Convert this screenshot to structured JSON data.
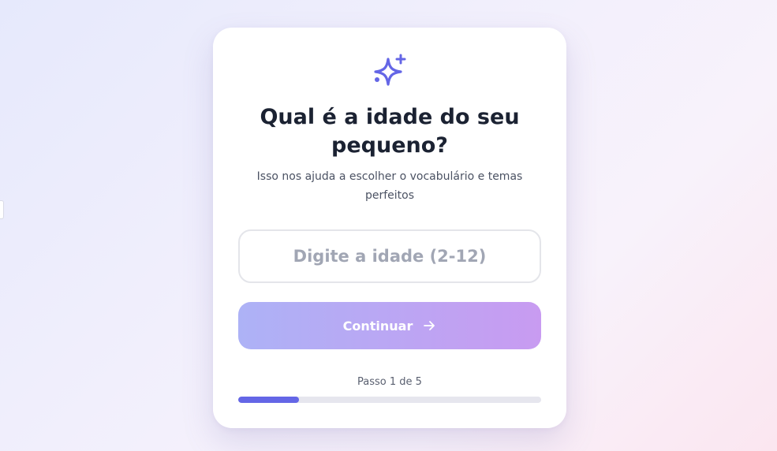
{
  "edge_handle": {},
  "card": {
    "icon": "sparkles-icon",
    "title": "Qual é a idade do seu pequeno?",
    "subtitle": "Isso nos ajuda a escolher o vocabulário e temas perfeitos",
    "age_input": {
      "value": "",
      "placeholder": "Digite a idade (2-12)"
    },
    "continue_button": {
      "label": "Continuar",
      "icon": "arrow-right-icon"
    },
    "progress": {
      "label": "Passo 1 de 5",
      "current_step": 1,
      "total_steps": 5
    }
  },
  "colors": {
    "accent": "#6466e6",
    "title_text": "#1b2232",
    "button_gradient_start": "#adb2f6",
    "button_gradient_end": "#c89bf1",
    "track": "#e6e6ee"
  }
}
